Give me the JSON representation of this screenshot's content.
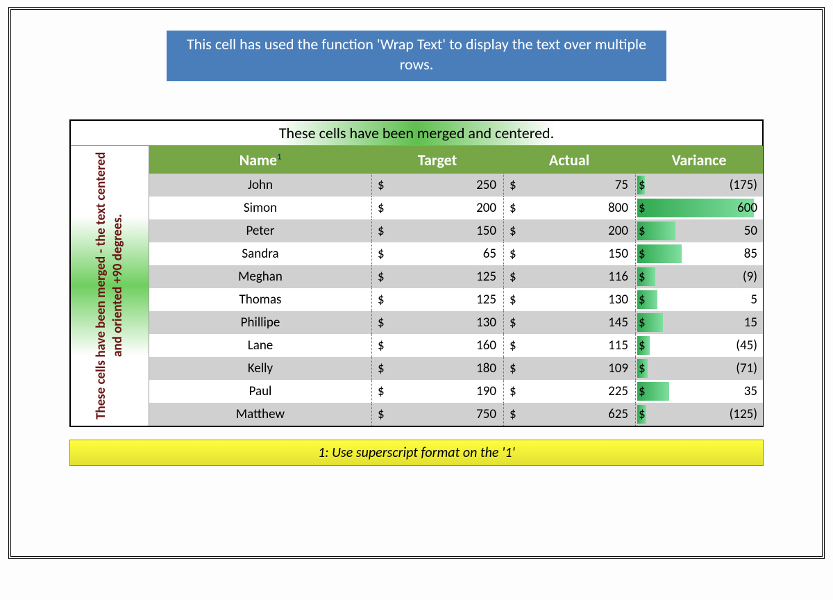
{
  "banner": "This cell has used the function 'Wrap Text' to display the text over multiple rows.",
  "merge_header": "These cells have been merged and centered.",
  "vertical_text": "These cells have been merged - the text centered and oriented +90 degrees.",
  "column_headers": {
    "name": "Name",
    "name_sup": "1",
    "target": "Target",
    "actual": "Actual",
    "variance": "Variance"
  },
  "currency_symbol": "$",
  "rows": [
    {
      "name": "John",
      "target": "250",
      "actual": "75",
      "variance": "(175)",
      "bar_pct": 6
    },
    {
      "name": "Simon",
      "target": "200",
      "actual": "800",
      "variance": "600",
      "bar_pct": 92
    },
    {
      "name": "Peter",
      "target": "150",
      "actual": "200",
      "variance": "50",
      "bar_pct": 30
    },
    {
      "name": "Sandra",
      "target": "65",
      "actual": "150",
      "variance": "85",
      "bar_pct": 35
    },
    {
      "name": "Meghan",
      "target": "125",
      "actual": "116",
      "variance": "(9)",
      "bar_pct": 14
    },
    {
      "name": "Thomas",
      "target": "125",
      "actual": "130",
      "variance": "5",
      "bar_pct": 16
    },
    {
      "name": "Phillipe",
      "target": "130",
      "actual": "145",
      "variance": "15",
      "bar_pct": 20
    },
    {
      "name": "Lane",
      "target": "160",
      "actual": "115",
      "variance": "(45)",
      "bar_pct": 10
    },
    {
      "name": "Kelly",
      "target": "180",
      "actual": "109",
      "variance": "(71)",
      "bar_pct": 8
    },
    {
      "name": "Paul",
      "target": "190",
      "actual": "225",
      "variance": "35",
      "bar_pct": 25
    },
    {
      "name": "Matthew",
      "target": "750",
      "actual": "625",
      "variance": "(125)",
      "bar_pct": 7
    }
  ],
  "footnote": "1: Use superscript format on the '1'",
  "chart_data": {
    "type": "table",
    "title": "These cells have been merged and centered.",
    "columns": [
      "Name",
      "Target",
      "Actual",
      "Variance"
    ],
    "rows": [
      [
        "John",
        250,
        75,
        -175
      ],
      [
        "Simon",
        200,
        800,
        600
      ],
      [
        "Peter",
        150,
        200,
        50
      ],
      [
        "Sandra",
        65,
        150,
        85
      ],
      [
        "Meghan",
        125,
        116,
        -9
      ],
      [
        "Thomas",
        125,
        130,
        5
      ],
      [
        "Phillipe",
        130,
        145,
        15
      ],
      [
        "Lane",
        160,
        115,
        -45
      ],
      [
        "Kelly",
        180,
        109,
        -71
      ],
      [
        "Paul",
        190,
        225,
        35
      ],
      [
        "Matthew",
        750,
        625,
        -125
      ]
    ]
  }
}
